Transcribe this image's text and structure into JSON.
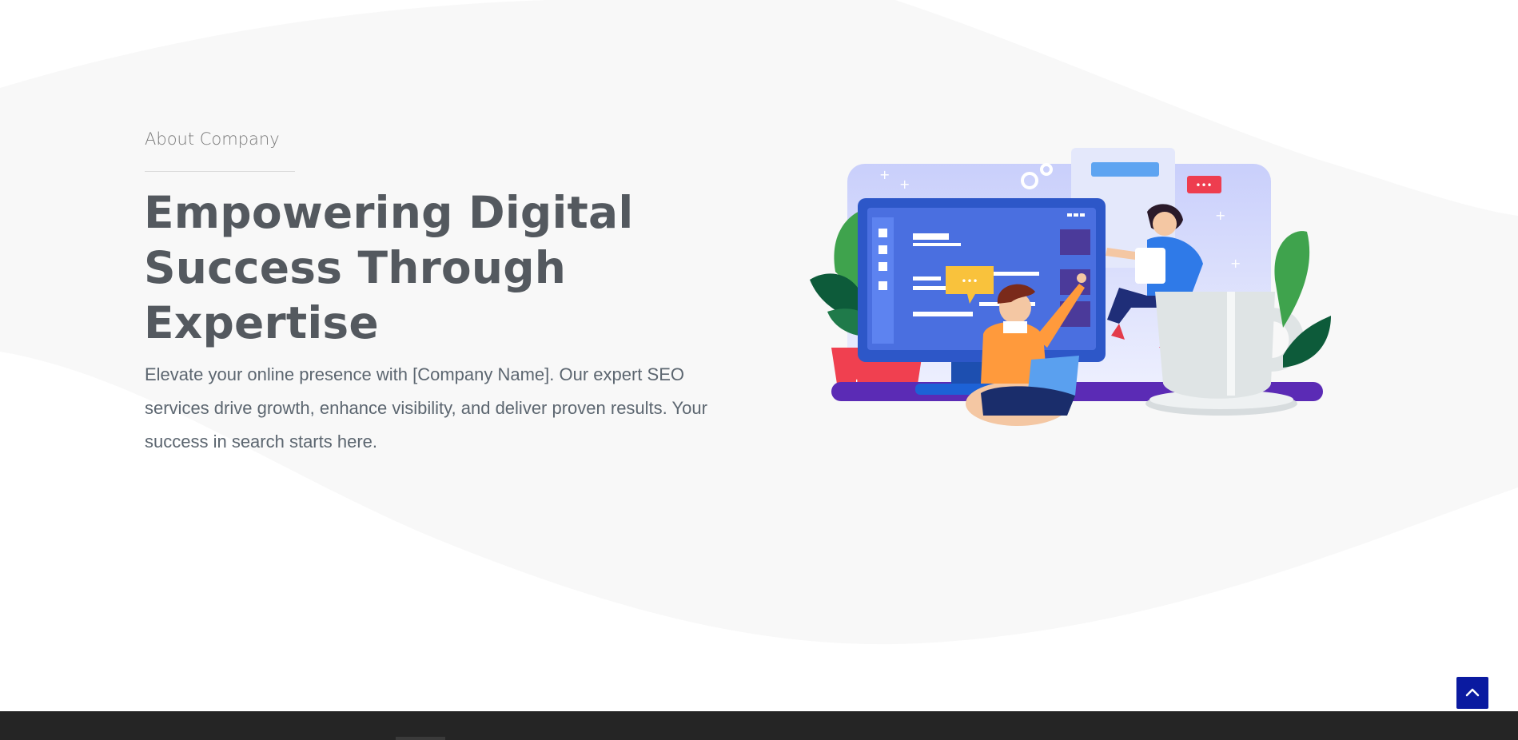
{
  "about": {
    "eyebrow": "About Company",
    "headline_lines": [
      "Empowering Digital",
      "Success Through",
      "Expertise"
    ],
    "body": "Elevate your online presence with [Company Name]. Our expert SEO services drive growth, enhance visibility, and deliver proven results. Your success in search starts here."
  },
  "illustration": {
    "icon": "seo-team-computer-illustration",
    "chat_bubble_text": "•••",
    "notification_text": "•••"
  },
  "scroll_top": {
    "icon": "chevron-up-icon"
  },
  "colors": {
    "heading": "#54595f",
    "body_text": "#5c6670",
    "eyebrow": "#7a7a7a",
    "background_wave": "#f8f8f8",
    "footer": "#252525",
    "scroll_top_button": "#0a1aa0",
    "monitor_blue": "#4a6fe0",
    "accent_orange": "#ff9a3c",
    "accent_red": "#f04050",
    "accent_purple": "#5b2bb5"
  }
}
